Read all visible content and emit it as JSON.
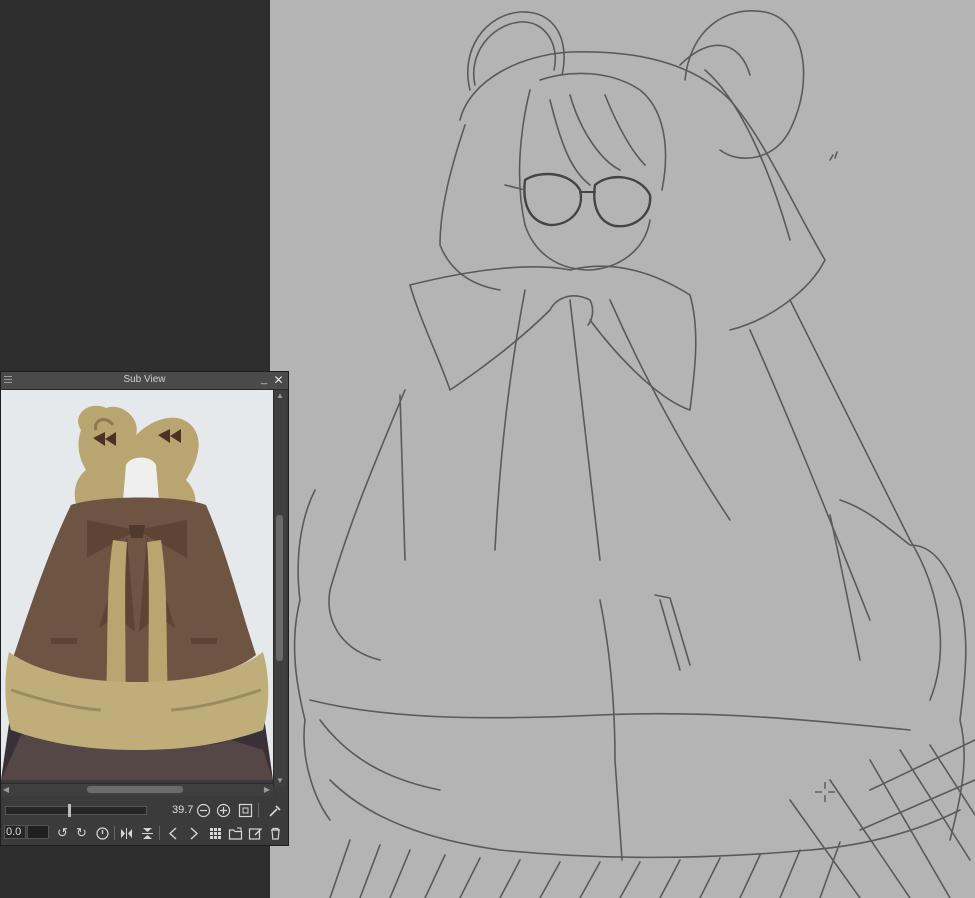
{
  "subview": {
    "title": "Sub View",
    "minimize_glyph": "_",
    "close_glyph": "✕",
    "zoom_value": "39.7",
    "zoom_slider_level": 0.45,
    "rotation_value": "0.0",
    "reference_image": "brown-fur-hooded-cape-with-bear-ears-and-bow",
    "icons": {
      "zoom_out": "zoom-out-icon",
      "zoom_in": "zoom-in-icon",
      "fit": "fit-to-window-icon",
      "eyedropper": "eyedropper-icon",
      "rotate_left": "rotate-left-icon",
      "rotate_right": "rotate-right-icon",
      "reset_rotation": "reset-rotation-icon",
      "flip_horizontal": "flip-horizontal-icon",
      "flip_vertical": "flip-vertical-icon",
      "prev": "previous-image-icon",
      "next": "next-image-icon",
      "thumbnails": "thumbnail-grid-icon",
      "import": "import-image-icon",
      "clear": "clear-image-icon",
      "delete": "trash-icon"
    }
  },
  "canvas": {
    "background": "#b4b4b4",
    "stroke_color": "#5a5a5a",
    "content": "rough-pencil-sketch-of-girl-in-hooded-fur-cape"
  },
  "colors": {
    "workspace": "#2e2e2e",
    "panel": "#3b3b3b",
    "cape_brown": "#6e5443",
    "fur_tan": "#c2b080"
  }
}
